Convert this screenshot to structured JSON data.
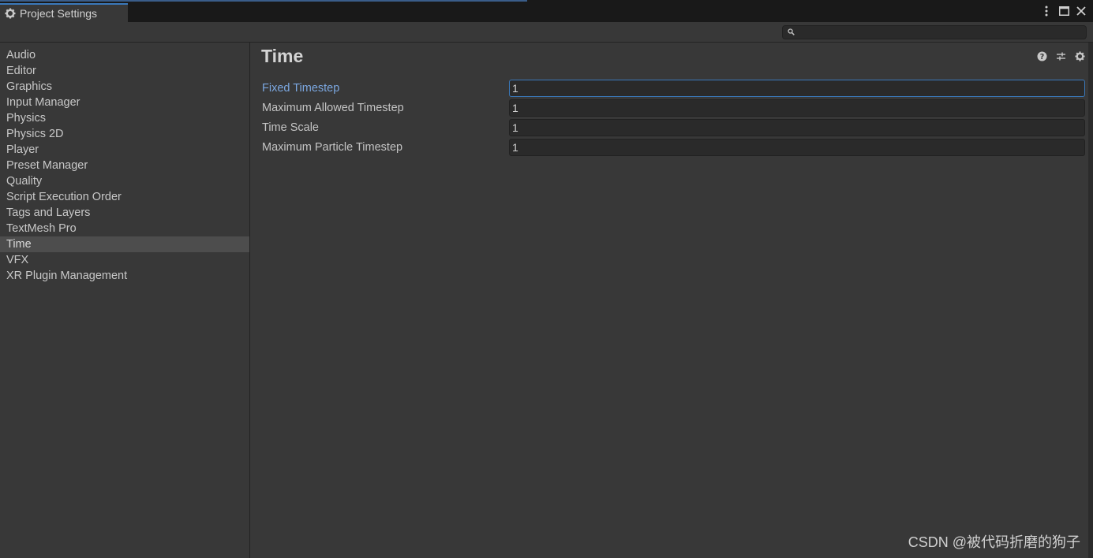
{
  "window": {
    "tab_title": "Project Settings",
    "tab_icon": "gear-icon"
  },
  "search": {
    "placeholder": "",
    "value": ""
  },
  "sidebar": {
    "items": [
      {
        "label": "Audio"
      },
      {
        "label": "Editor"
      },
      {
        "label": "Graphics"
      },
      {
        "label": "Input Manager"
      },
      {
        "label": "Physics"
      },
      {
        "label": "Physics 2D"
      },
      {
        "label": "Player"
      },
      {
        "label": "Preset Manager"
      },
      {
        "label": "Quality"
      },
      {
        "label": "Script Execution Order"
      },
      {
        "label": "Tags and Layers"
      },
      {
        "label": "TextMesh Pro"
      },
      {
        "label": "Time"
      },
      {
        "label": "VFX"
      },
      {
        "label": "XR Plugin Management"
      }
    ],
    "selected": "Time"
  },
  "main": {
    "title": "Time",
    "properties": [
      {
        "label": "Fixed Timestep",
        "value": "1",
        "focused": true
      },
      {
        "label": "Maximum Allowed Timestep",
        "value": "1"
      },
      {
        "label": "Time Scale",
        "value": "1"
      },
      {
        "label": "Maximum Particle Timestep",
        "value": "1"
      }
    ]
  },
  "watermark": "CSDN @被代码折磨的狗子",
  "colors": {
    "background": "#383838",
    "field": "#2a2a2a",
    "accent": "#3a79bb",
    "focused_label": "#7ba7e0"
  }
}
